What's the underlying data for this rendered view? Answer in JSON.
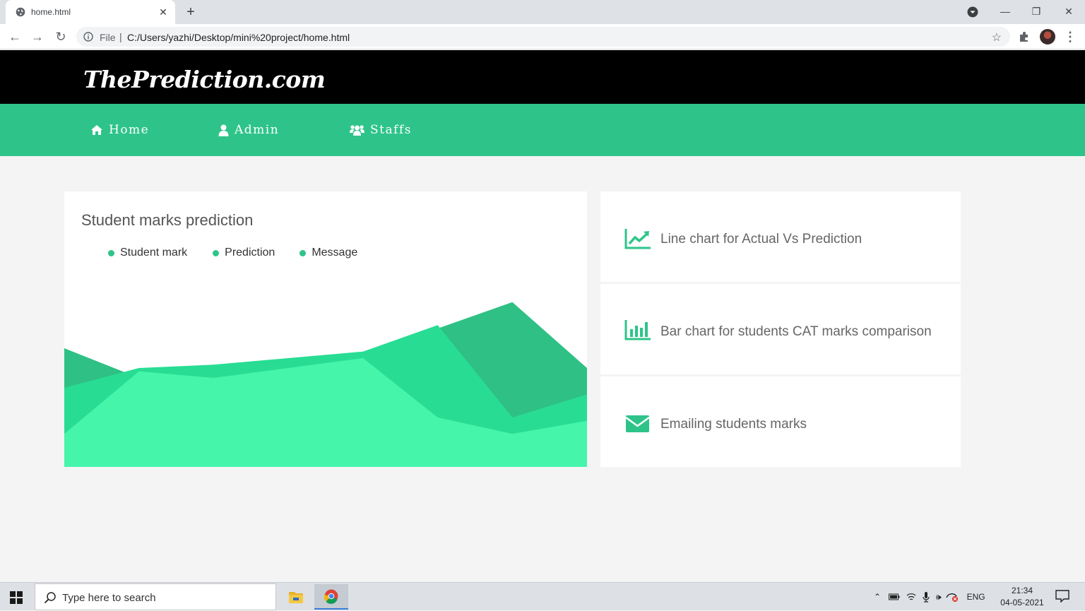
{
  "browser": {
    "tab_title": "home.html",
    "tab_close": "✕",
    "new_tab": "+",
    "file_label": "File",
    "separator": "|",
    "url": "C:/Users/yazhi/Desktop/mini%20project/home.html",
    "window_controls": {
      "minimize": "—",
      "restore": "❐",
      "close": "✕"
    }
  },
  "site": {
    "logo": "ThePrediction.com",
    "nav": [
      {
        "label": "Home",
        "icon": "home-icon"
      },
      {
        "label": "Admin",
        "icon": "user-icon"
      },
      {
        "label": "Staffs",
        "icon": "users-icon"
      }
    ],
    "accent_color": "#2ec489"
  },
  "main_card": {
    "title": "Student marks prediction",
    "legend": [
      "Student mark",
      "Prediction",
      "Message"
    ]
  },
  "chart_data": {
    "type": "area",
    "title": "Student marks prediction",
    "series": [
      {
        "name": "Student mark",
        "color": "#2fc085",
        "x": [
          0,
          1,
          2,
          3,
          4,
          5,
          6,
          7
        ],
        "values": [
          36,
          27,
          28,
          30,
          33,
          42,
          50,
          30
        ]
      },
      {
        "name": "Prediction",
        "color": "#28dd93",
        "x": [
          0,
          1,
          2,
          3,
          4,
          5,
          6,
          7
        ],
        "values": [
          24,
          30,
          31,
          33,
          35,
          43,
          15,
          22
        ]
      },
      {
        "name": "Message",
        "color": "#45f5aa",
        "x": [
          0,
          1,
          2,
          3,
          4,
          5,
          6,
          7
        ],
        "values": [
          10,
          29,
          27,
          30,
          33,
          15,
          10,
          14
        ]
      }
    ],
    "ylim": [
      0,
      60
    ],
    "grid": false,
    "legend_position": "top"
  },
  "side_cards": [
    {
      "label": "Line chart for Actual Vs Prediction",
      "icon": "line-chart-icon"
    },
    {
      "label": "Bar chart for students CAT marks comparison",
      "icon": "bar-chart-icon"
    },
    {
      "label": "Emailing students marks",
      "icon": "envelope-icon"
    }
  ],
  "taskbar": {
    "search_placeholder": "Type here to search",
    "language": "ENG",
    "time": "21:34",
    "date": "04-05-2021"
  }
}
